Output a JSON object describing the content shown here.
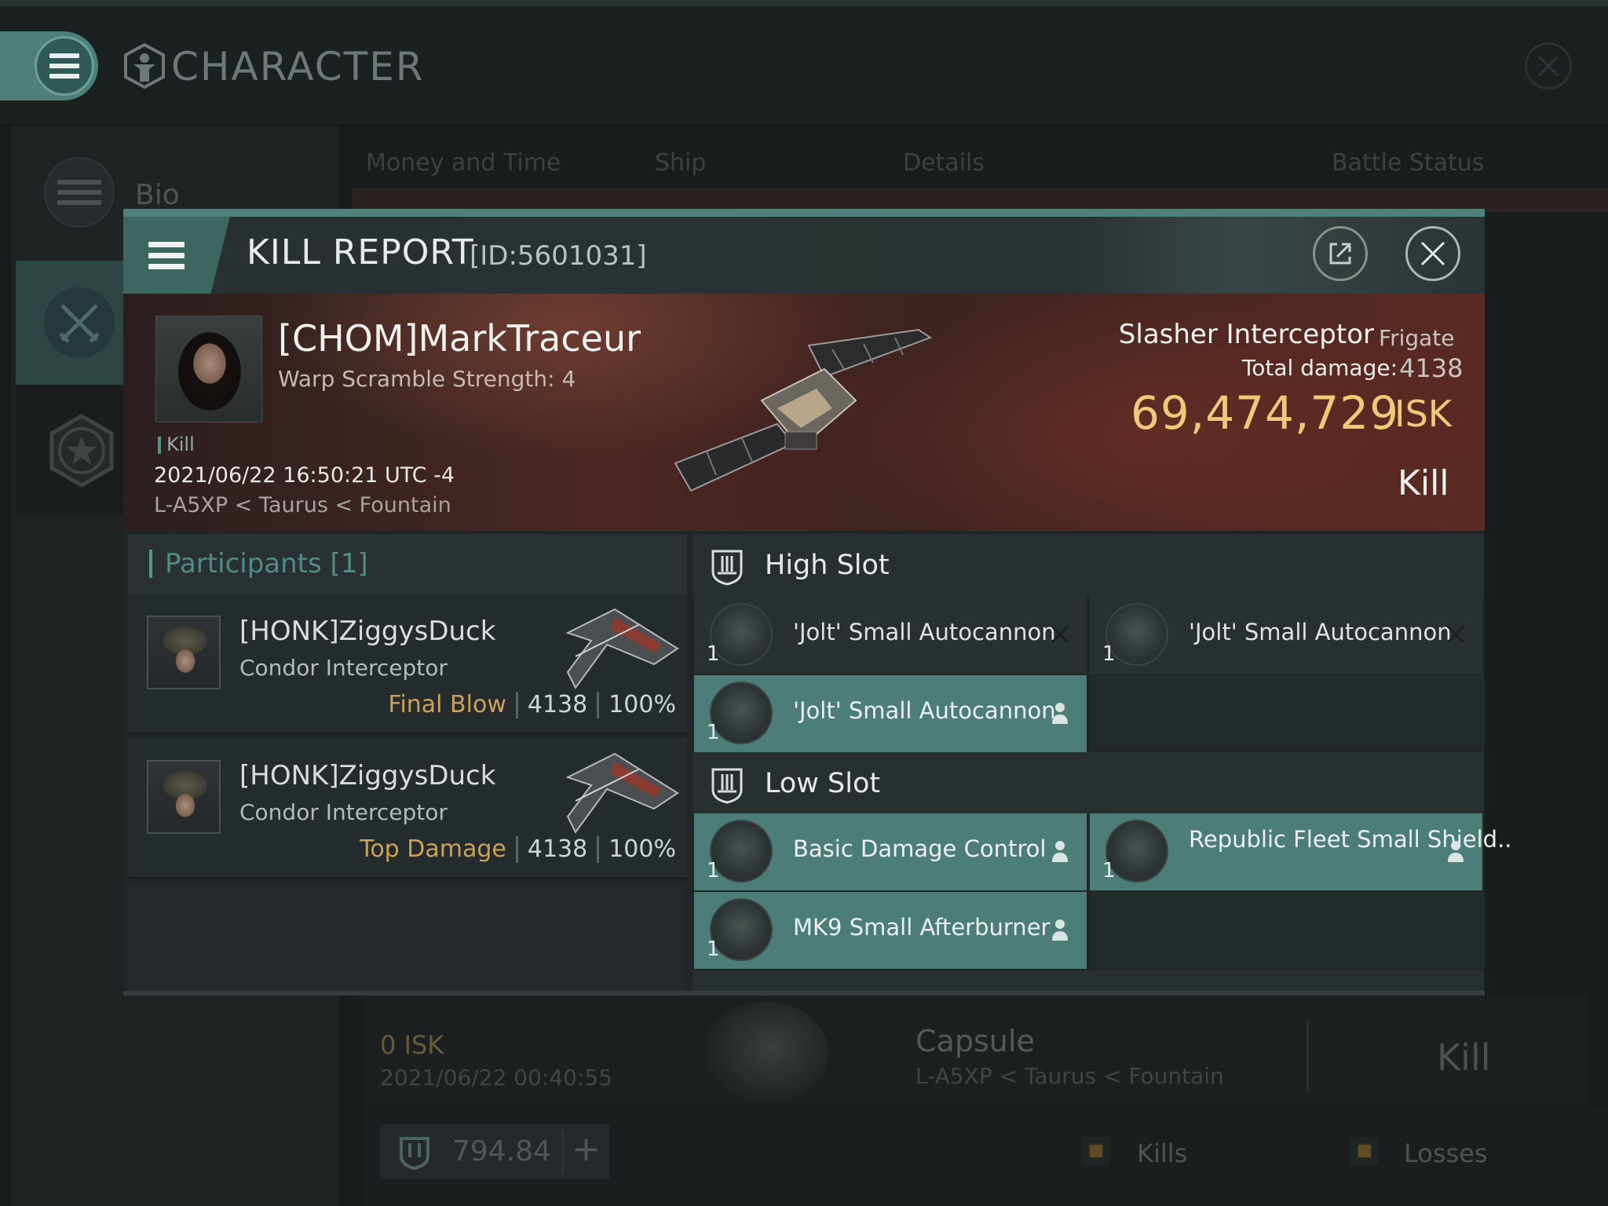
{
  "app": {
    "title": "CHARACTER"
  },
  "sidebar": {
    "items": [
      {
        "label": "Bio",
        "icon": "list-icon"
      },
      {
        "label": "",
        "icon": "crossed-swords-icon"
      },
      {
        "label": "",
        "icon": "star-badge-icon"
      }
    ]
  },
  "background_panel": {
    "tabs": [
      "Money and Time",
      "Ship",
      "Details",
      "Battle Status"
    ],
    "capsule_row": {
      "isk": "0  ISK",
      "date": "2021/06/22  00:40:55",
      "ship": "Capsule",
      "location": "L-A5XP < Taurus < Fountain",
      "result": "Kill"
    },
    "bottom_bar": {
      "plex_value": "794.84",
      "add_symbol": "+",
      "legend": [
        "Kills",
        "Losses"
      ]
    }
  },
  "kill_report": {
    "title": "KILL REPORT",
    "id": "[ID:5601031]",
    "victim": {
      "name": "[CHOM]MarkTraceur",
      "warp_scramble": "Warp Scramble Strength: 4",
      "tag": "Kill",
      "datetime": "2021/06/22 16:50:21 UTC -4",
      "location": "L-A5XP < Taurus < Fountain"
    },
    "ship": {
      "name": "Slasher Interceptor",
      "class": "Frigate",
      "total_damage_label": "Total damage:",
      "total_damage": "4138",
      "isk_value": "69,474,729",
      "isk_unit": "ISK",
      "result": "Kill"
    },
    "participants": {
      "title": "Participants [1]",
      "list": [
        {
          "name": "[HONK]ZiggysDuck",
          "ship": "Condor Interceptor",
          "tag": "Final Blow",
          "damage": "4138",
          "percent": "100%"
        },
        {
          "name": "[HONK]ZiggysDuck",
          "ship": "Condor Interceptor",
          "tag": "Top Damage",
          "damage": "4138",
          "percent": "100%"
        }
      ]
    },
    "fitting": {
      "high_slot": {
        "title": "High Slot",
        "modules": [
          {
            "name": "'Jolt' Small Autocannon",
            "qty": "1",
            "status": "destroyed"
          },
          {
            "name": "'Jolt' Small Autocannon",
            "qty": "1",
            "status": "destroyed"
          },
          {
            "name": "'Jolt' Small Autocannon",
            "qty": "1",
            "status": "dropped"
          }
        ]
      },
      "low_slot": {
        "title": "Low Slot",
        "modules": [
          {
            "name": "Basic Damage Control",
            "qty": "1",
            "status": "dropped"
          },
          {
            "name": "Republic Fleet Small Shield..",
            "qty": "1",
            "status": "dropped"
          },
          {
            "name": "MK9 Small Afterburner",
            "qty": "1",
            "status": "dropped"
          }
        ]
      }
    }
  },
  "colors": {
    "accent": "#4e837c",
    "isk_gold": "#f2c879",
    "fitted_module": "#4c7d77",
    "tag_gold": "#c9a35c"
  }
}
